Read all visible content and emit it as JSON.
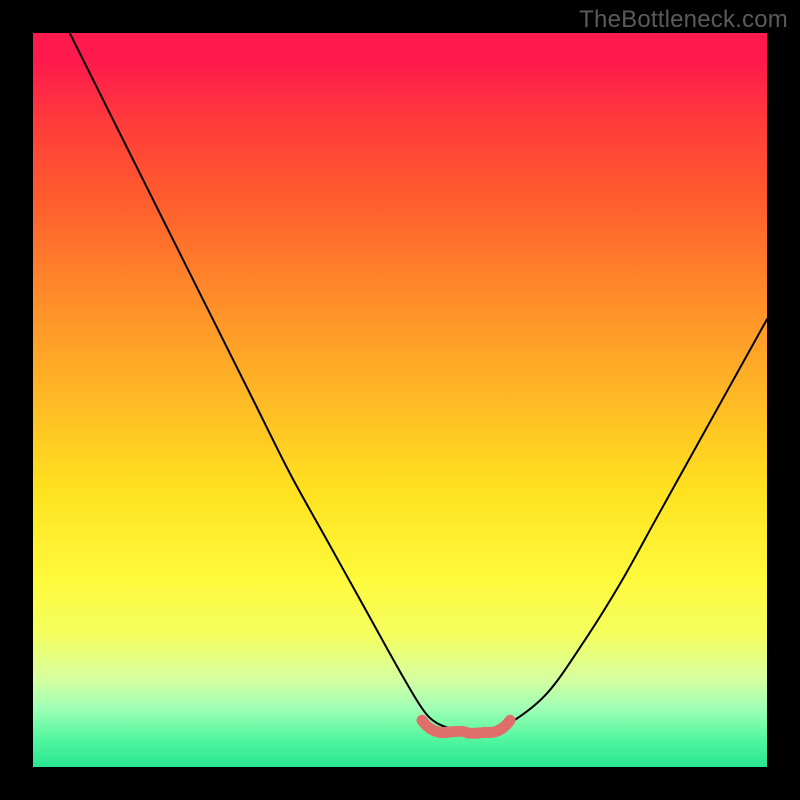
{
  "watermark": "TheBottleneck.com",
  "chart_data": {
    "type": "line",
    "title": "",
    "xlabel": "",
    "ylabel": "",
    "xlim": [
      0,
      100
    ],
    "ylim": [
      0,
      100
    ],
    "series": [
      {
        "name": "curve",
        "x": [
          5,
          10,
          15,
          20,
          25,
          30,
          35,
          40,
          45,
          50,
          53,
          55,
          58,
          60,
          62,
          65,
          70,
          75,
          80,
          85,
          90,
          95,
          100
        ],
        "values": [
          100,
          90,
          80,
          70,
          60,
          50,
          40,
          31,
          22,
          13,
          8,
          6,
          5,
          5,
          5,
          6,
          10,
          17,
          25,
          34,
          43,
          52,
          61
        ]
      }
    ],
    "highlight": {
      "name": "bottom-band",
      "color": "#e06f6b",
      "x_range": [
        53,
        65
      ],
      "y": 5
    },
    "background_gradient": {
      "top": "#ff1a4d",
      "bottom": "#29e58f"
    }
  }
}
